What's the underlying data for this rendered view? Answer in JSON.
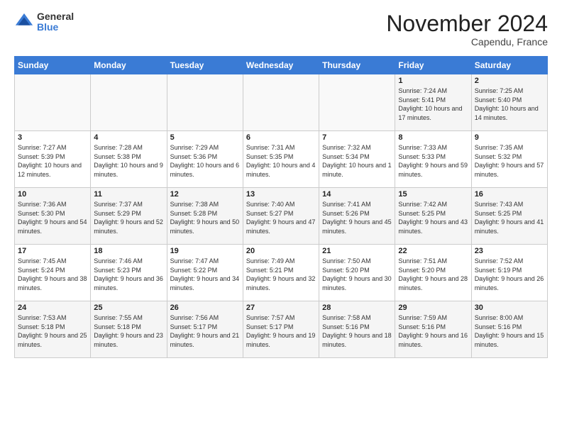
{
  "logo": {
    "general": "General",
    "blue": "Blue"
  },
  "header": {
    "month": "November 2024",
    "location": "Capendu, France"
  },
  "days_of_week": [
    "Sunday",
    "Monday",
    "Tuesday",
    "Wednesday",
    "Thursday",
    "Friday",
    "Saturday"
  ],
  "weeks": [
    [
      {
        "day": "",
        "info": ""
      },
      {
        "day": "",
        "info": ""
      },
      {
        "day": "",
        "info": ""
      },
      {
        "day": "",
        "info": ""
      },
      {
        "day": "",
        "info": ""
      },
      {
        "day": "1",
        "info": "Sunrise: 7:24 AM\nSunset: 5:41 PM\nDaylight: 10 hours and 17 minutes."
      },
      {
        "day": "2",
        "info": "Sunrise: 7:25 AM\nSunset: 5:40 PM\nDaylight: 10 hours and 14 minutes."
      }
    ],
    [
      {
        "day": "3",
        "info": "Sunrise: 7:27 AM\nSunset: 5:39 PM\nDaylight: 10 hours and 12 minutes."
      },
      {
        "day": "4",
        "info": "Sunrise: 7:28 AM\nSunset: 5:38 PM\nDaylight: 10 hours and 9 minutes."
      },
      {
        "day": "5",
        "info": "Sunrise: 7:29 AM\nSunset: 5:36 PM\nDaylight: 10 hours and 6 minutes."
      },
      {
        "day": "6",
        "info": "Sunrise: 7:31 AM\nSunset: 5:35 PM\nDaylight: 10 hours and 4 minutes."
      },
      {
        "day": "7",
        "info": "Sunrise: 7:32 AM\nSunset: 5:34 PM\nDaylight: 10 hours and 1 minute."
      },
      {
        "day": "8",
        "info": "Sunrise: 7:33 AM\nSunset: 5:33 PM\nDaylight: 9 hours and 59 minutes."
      },
      {
        "day": "9",
        "info": "Sunrise: 7:35 AM\nSunset: 5:32 PM\nDaylight: 9 hours and 57 minutes."
      }
    ],
    [
      {
        "day": "10",
        "info": "Sunrise: 7:36 AM\nSunset: 5:30 PM\nDaylight: 9 hours and 54 minutes."
      },
      {
        "day": "11",
        "info": "Sunrise: 7:37 AM\nSunset: 5:29 PM\nDaylight: 9 hours and 52 minutes."
      },
      {
        "day": "12",
        "info": "Sunrise: 7:38 AM\nSunset: 5:28 PM\nDaylight: 9 hours and 50 minutes."
      },
      {
        "day": "13",
        "info": "Sunrise: 7:40 AM\nSunset: 5:27 PM\nDaylight: 9 hours and 47 minutes."
      },
      {
        "day": "14",
        "info": "Sunrise: 7:41 AM\nSunset: 5:26 PM\nDaylight: 9 hours and 45 minutes."
      },
      {
        "day": "15",
        "info": "Sunrise: 7:42 AM\nSunset: 5:25 PM\nDaylight: 9 hours and 43 minutes."
      },
      {
        "day": "16",
        "info": "Sunrise: 7:43 AM\nSunset: 5:25 PM\nDaylight: 9 hours and 41 minutes."
      }
    ],
    [
      {
        "day": "17",
        "info": "Sunrise: 7:45 AM\nSunset: 5:24 PM\nDaylight: 9 hours and 38 minutes."
      },
      {
        "day": "18",
        "info": "Sunrise: 7:46 AM\nSunset: 5:23 PM\nDaylight: 9 hours and 36 minutes."
      },
      {
        "day": "19",
        "info": "Sunrise: 7:47 AM\nSunset: 5:22 PM\nDaylight: 9 hours and 34 minutes."
      },
      {
        "day": "20",
        "info": "Sunrise: 7:49 AM\nSunset: 5:21 PM\nDaylight: 9 hours and 32 minutes."
      },
      {
        "day": "21",
        "info": "Sunrise: 7:50 AM\nSunset: 5:20 PM\nDaylight: 9 hours and 30 minutes."
      },
      {
        "day": "22",
        "info": "Sunrise: 7:51 AM\nSunset: 5:20 PM\nDaylight: 9 hours and 28 minutes."
      },
      {
        "day": "23",
        "info": "Sunrise: 7:52 AM\nSunset: 5:19 PM\nDaylight: 9 hours and 26 minutes."
      }
    ],
    [
      {
        "day": "24",
        "info": "Sunrise: 7:53 AM\nSunset: 5:18 PM\nDaylight: 9 hours and 25 minutes."
      },
      {
        "day": "25",
        "info": "Sunrise: 7:55 AM\nSunset: 5:18 PM\nDaylight: 9 hours and 23 minutes."
      },
      {
        "day": "26",
        "info": "Sunrise: 7:56 AM\nSunset: 5:17 PM\nDaylight: 9 hours and 21 minutes."
      },
      {
        "day": "27",
        "info": "Sunrise: 7:57 AM\nSunset: 5:17 PM\nDaylight: 9 hours and 19 minutes."
      },
      {
        "day": "28",
        "info": "Sunrise: 7:58 AM\nSunset: 5:16 PM\nDaylight: 9 hours and 18 minutes."
      },
      {
        "day": "29",
        "info": "Sunrise: 7:59 AM\nSunset: 5:16 PM\nDaylight: 9 hours and 16 minutes."
      },
      {
        "day": "30",
        "info": "Sunrise: 8:00 AM\nSunset: 5:16 PM\nDaylight: 9 hours and 15 minutes."
      }
    ]
  ]
}
